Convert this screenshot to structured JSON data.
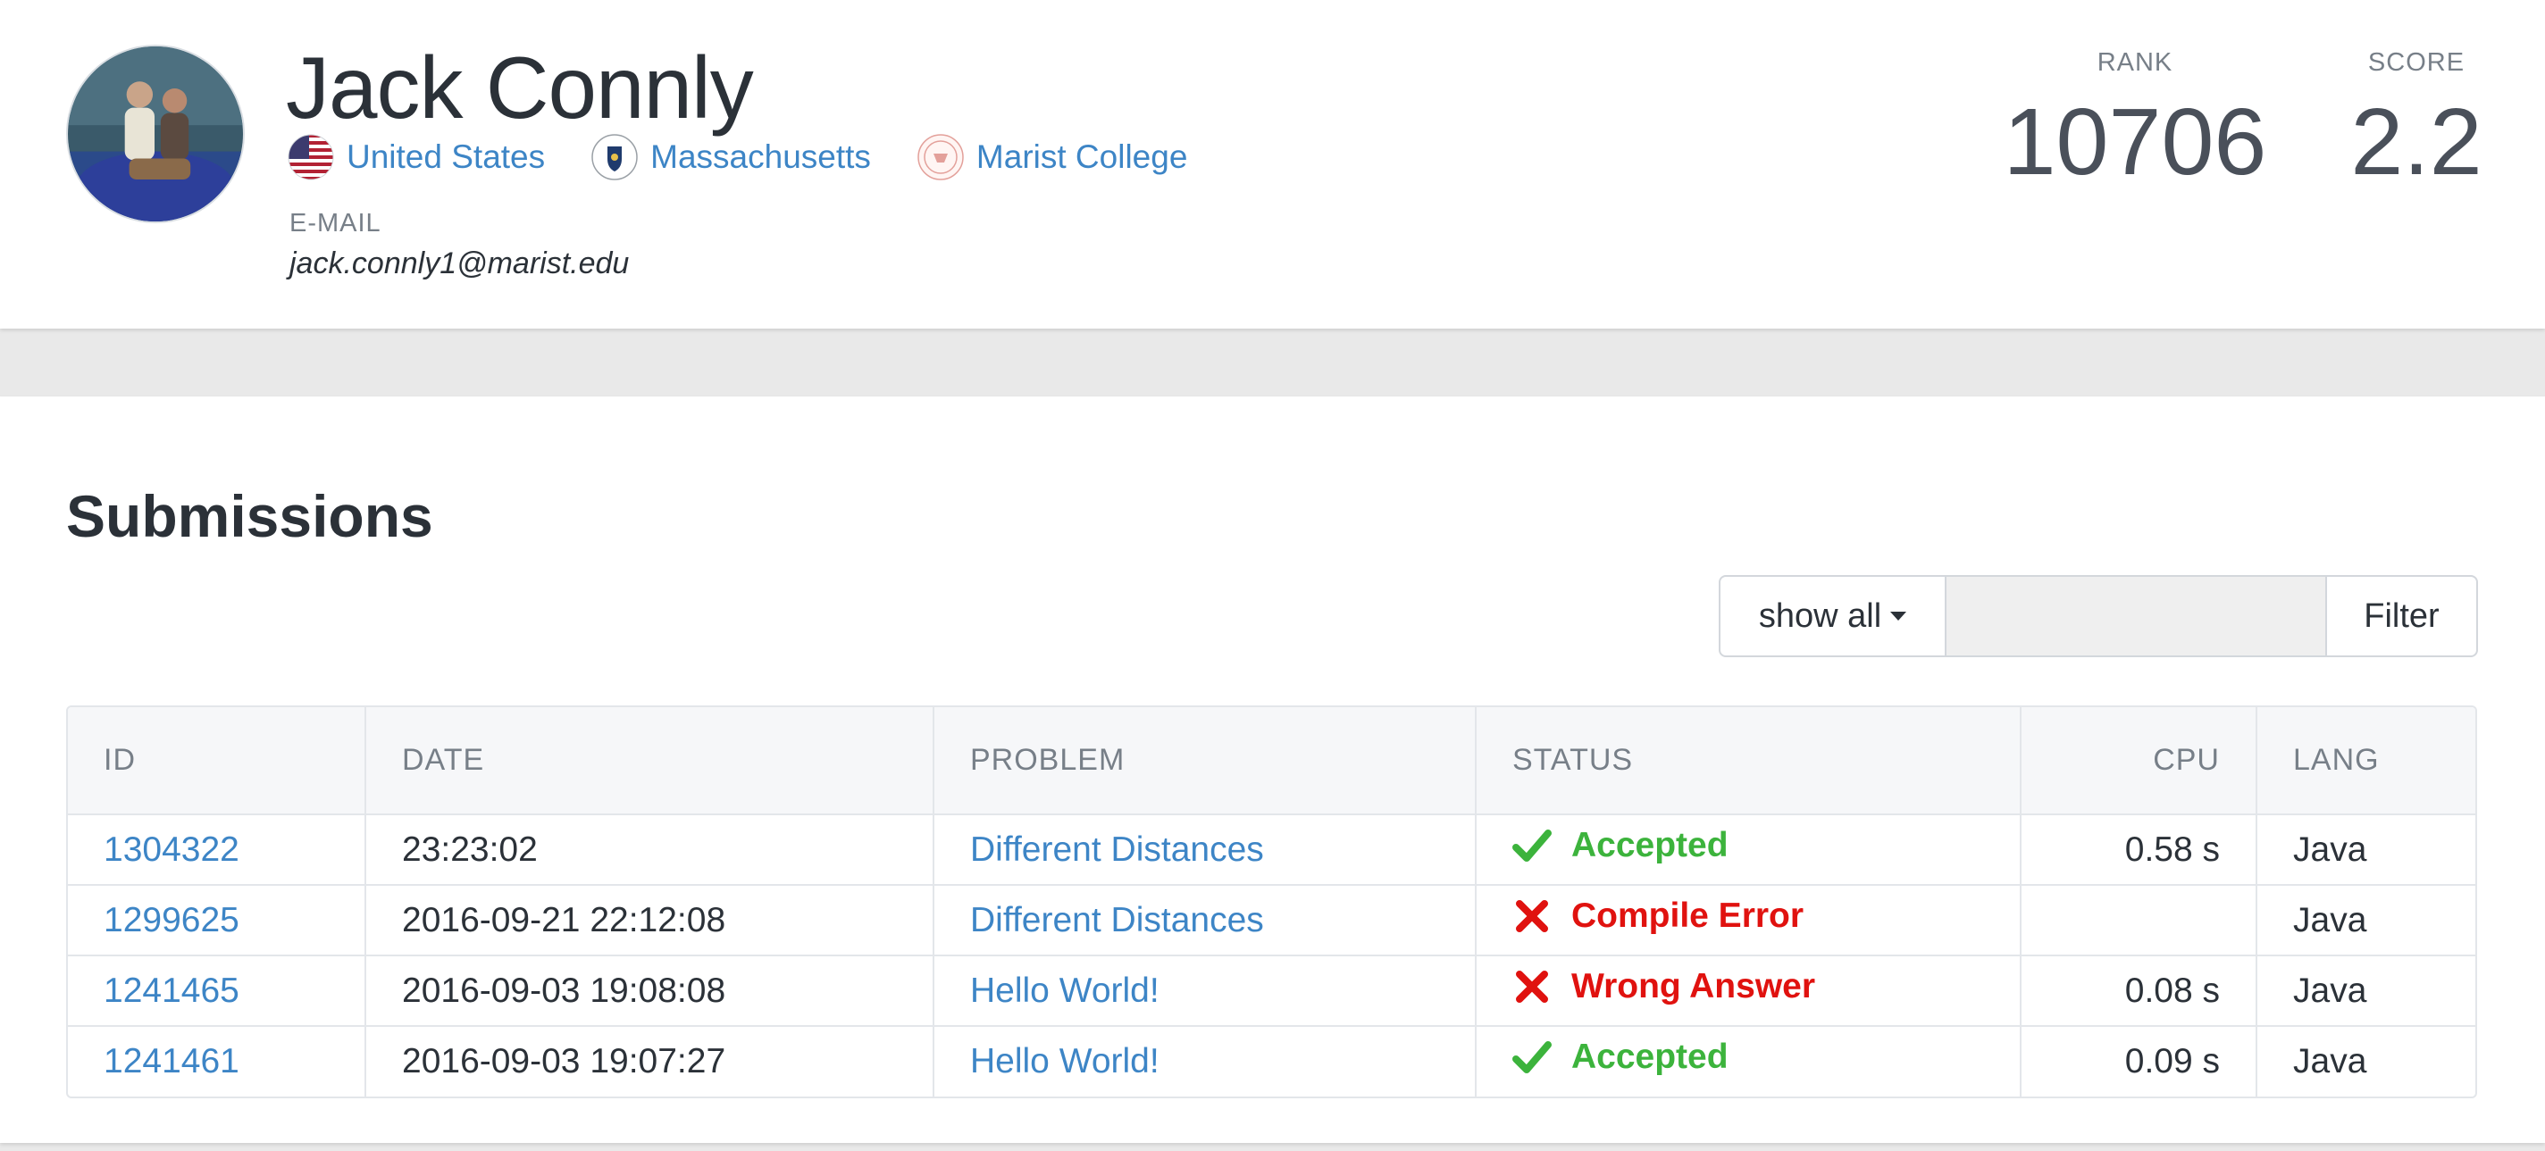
{
  "profile": {
    "name": "Jack Connly",
    "country": "United States",
    "state": "Massachusetts",
    "school": "Marist College",
    "email_label": "E-MAIL",
    "email": "jack.connly1@marist.edu",
    "rank_label": "RANK",
    "rank": "10706",
    "score_label": "SCORE",
    "score": "2.2"
  },
  "submissions": {
    "title": "Submissions",
    "filter_select": "show all",
    "filter_placeholder": "",
    "filter_button": "Filter",
    "columns": {
      "id": "ID",
      "date": "DATE",
      "problem": "PROBLEM",
      "status": "STATUS",
      "cpu": "CPU",
      "lang": "LANG"
    },
    "rows": [
      {
        "id": "1304322",
        "date": "23:23:02",
        "problem": "Different Distances",
        "status": "Accepted",
        "status_icon": "check-icon",
        "cpu": "0.58 s",
        "lang": "Java"
      },
      {
        "id": "1299625",
        "date": "2016-09-21 22:12:08",
        "problem": "Different Distances",
        "status": "Compile Error",
        "status_icon": "x-icon",
        "cpu": "",
        "lang": "Java"
      },
      {
        "id": "1241465",
        "date": "2016-09-03 19:08:08",
        "problem": "Hello World!",
        "status": "Wrong Answer",
        "status_icon": "x-icon",
        "cpu": "0.08 s",
        "lang": "Java"
      },
      {
        "id": "1241461",
        "date": "2016-09-03 19:07:27",
        "problem": "Hello World!",
        "status": "Accepted",
        "status_icon": "check-icon",
        "cpu": "0.09 s",
        "lang": "Java"
      }
    ]
  },
  "colors": {
    "link": "#3d85c6",
    "accepted": "#3cb33c",
    "error": "#e0120f",
    "text": "#2b3138",
    "muted": "#777f88"
  }
}
